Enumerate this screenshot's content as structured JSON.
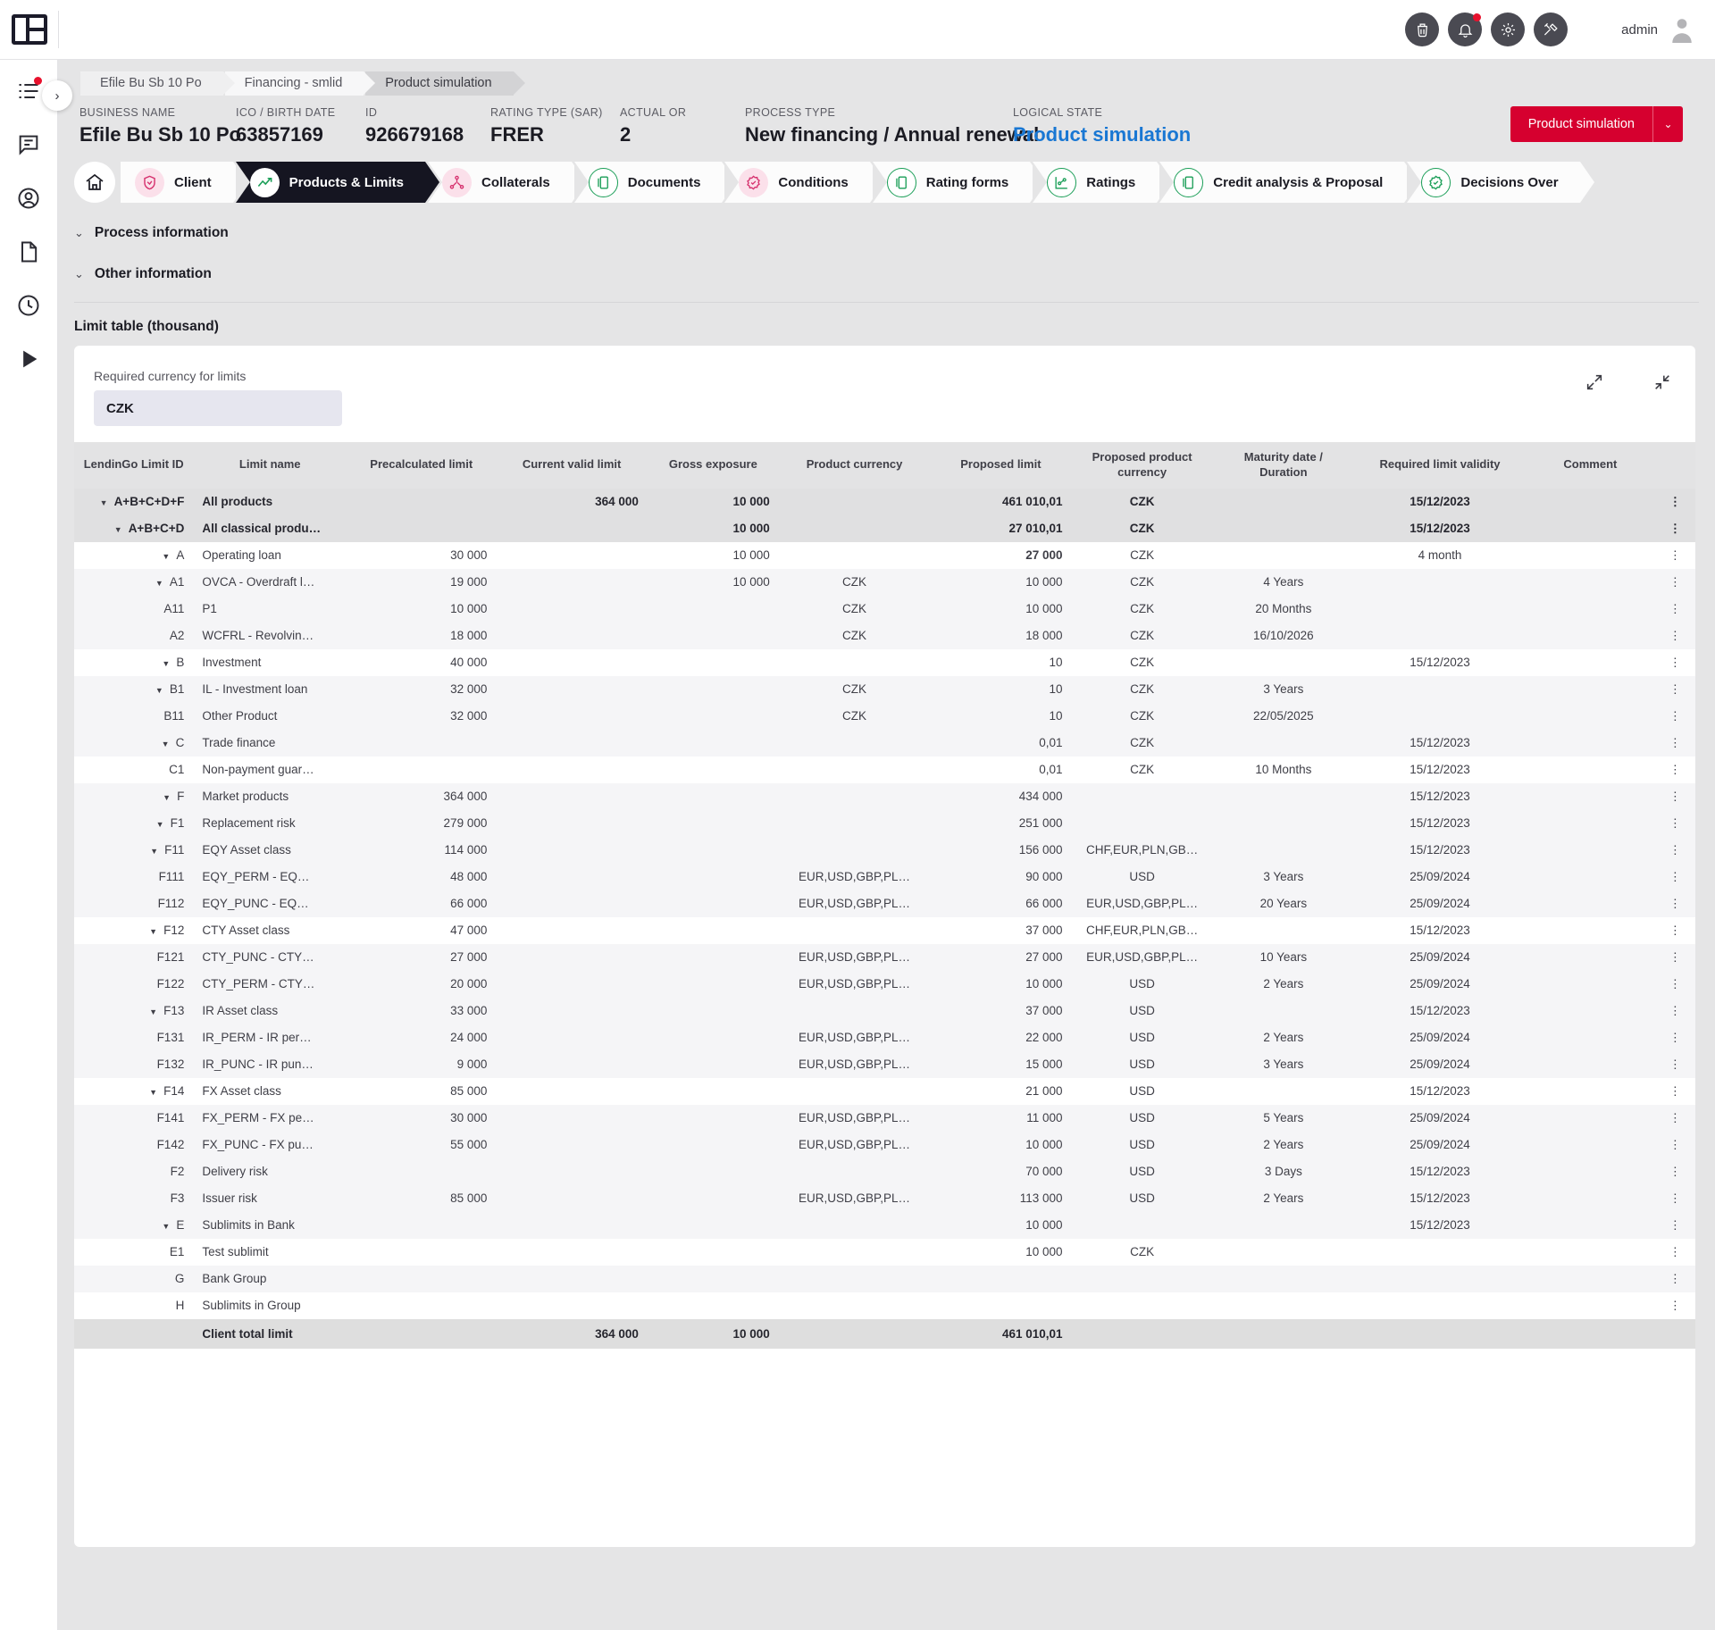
{
  "topbar": {
    "icons": [
      "shield-icon",
      "bell-icon",
      "gear-icon",
      "tools-icon"
    ],
    "user": "admin"
  },
  "rail": {
    "items": [
      "task-list-icon",
      "comment-icon",
      "user-circle-icon",
      "document-icon",
      "clock-icon",
      "play-icon"
    ],
    "expand": "›"
  },
  "breadcrumb": {
    "items": [
      "Efile Bu Sb 10 Po",
      "Financing - smlid",
      "Product simulation"
    ]
  },
  "summary": {
    "fields": [
      {
        "label": "BUSINESS NAME",
        "value": "Efile Bu Sb 10 Po"
      },
      {
        "label": "ICO / BIRTH DATE",
        "value": "63857169"
      },
      {
        "label": "ID",
        "value": "926679168"
      },
      {
        "label": "RATING TYPE (SAR)",
        "value": "FRER"
      },
      {
        "label": "ACTUAL OR",
        "value": "2"
      },
      {
        "label": "PROCESS TYPE",
        "value": "New financing / Annual renewal"
      },
      {
        "label": "LOGICAL STATE",
        "value": "Product simulation"
      }
    ],
    "action_button": "Product simulation",
    "action_caret": "⌄"
  },
  "steps": [
    {
      "label": "Client",
      "icon": "shield-heart-icon"
    },
    {
      "label": "Products & Limits",
      "icon": "trend-up-icon"
    },
    {
      "label": "Collaterals",
      "icon": "collateral-icon"
    },
    {
      "label": "Documents",
      "icon": "documents-icon"
    },
    {
      "label": "Conditions",
      "icon": "check-badge-icon"
    },
    {
      "label": "Rating forms",
      "icon": "documents-icon"
    },
    {
      "label": "Ratings",
      "icon": "graph-icon"
    },
    {
      "label": "Credit analysis & Proposal",
      "icon": "documents-icon"
    },
    {
      "label": "Decisions Over",
      "icon": "check-badge-icon"
    }
  ],
  "accordions": [
    {
      "label": "Process information",
      "chevron": "⌄"
    },
    {
      "label": "Other information",
      "chevron": "⌄"
    }
  ],
  "limit_table": {
    "title": "Limit table (thousand)",
    "currency_label": "Required currency for limits",
    "currency_value": "CZK",
    "tools": [
      "expand-icon",
      "collapse-icon"
    ],
    "row_menu": "⋮",
    "columns": [
      "LendinGo Limit ID",
      "Limit name",
      "Precalculated limit",
      "Current valid limit",
      "Gross exposure",
      "Product currency",
      "Proposed limit",
      "Proposed product currency",
      "Maturity date / Duration",
      "Required limit validity",
      "Comment"
    ],
    "rows": [
      {
        "id": "A+B+C+D+F",
        "indent": 0,
        "caret": true,
        "name": "All products",
        "pre": "",
        "cur": "364 000",
        "gross": "10 000",
        "pcur": "",
        "prop": "461 010,01",
        "propbold": false,
        "ppcur": "CZK",
        "mat": "",
        "val": "15/12/2023",
        "com": "",
        "style": "head"
      },
      {
        "id": "A+B+C+D",
        "indent": 1,
        "caret": true,
        "name": "All classical produ…",
        "pre": "",
        "cur": "",
        "gross": "10 000",
        "pcur": "",
        "prop": "27 010,01",
        "propbold": false,
        "ppcur": "CZK",
        "mat": "",
        "val": "15/12/2023",
        "com": "",
        "style": "head"
      },
      {
        "id": "A",
        "indent": 2,
        "caret": true,
        "name": "Operating loan",
        "pre": "30 000",
        "cur": "",
        "gross": "10 000",
        "pcur": "",
        "prop": "27 000",
        "propbold": true,
        "ppcur": "CZK",
        "mat": "",
        "val": "4 month",
        "com": "",
        "style": "even"
      },
      {
        "id": "A1",
        "indent": 3,
        "caret": true,
        "name": "OVCA - Overdraft l…",
        "pre": "19 000",
        "cur": "",
        "gross": "10 000",
        "pcur": "CZK",
        "prop": "10 000",
        "propbold": false,
        "ppcur": "CZK",
        "mat": "4 Years",
        "val": "",
        "com": "",
        "style": "odd"
      },
      {
        "id": "A11",
        "indent": 4,
        "caret": false,
        "name": "P1",
        "pre": "10 000",
        "cur": "",
        "gross": "",
        "pcur": "CZK",
        "prop": "10 000",
        "propbold": false,
        "ppcur": "CZK",
        "mat": "20 Months",
        "val": "",
        "com": "",
        "style": "odd"
      },
      {
        "id": "A2",
        "indent": 4,
        "caret": false,
        "name": "WCFRL - Revolvin…",
        "pre": "18 000",
        "cur": "",
        "gross": "",
        "pcur": "CZK",
        "prop": "18 000",
        "propbold": false,
        "ppcur": "CZK",
        "mat": "16/10/2026",
        "val": "",
        "com": "",
        "style": "odd"
      },
      {
        "id": "B",
        "indent": 2,
        "caret": true,
        "name": "Investment",
        "pre": "40 000",
        "cur": "",
        "gross": "",
        "pcur": "",
        "prop": "10",
        "propbold": false,
        "ppcur": "CZK",
        "mat": "",
        "val": "15/12/2023",
        "com": "",
        "style": "even"
      },
      {
        "id": "B1",
        "indent": 3,
        "caret": true,
        "name": "IL - Investment loan",
        "pre": "32 000",
        "cur": "",
        "gross": "",
        "pcur": "CZK",
        "prop": "10",
        "propbold": false,
        "ppcur": "CZK",
        "mat": "3 Years",
        "val": "",
        "com": "",
        "style": "odd"
      },
      {
        "id": "B11",
        "indent": 4,
        "caret": false,
        "name": "Other Product",
        "pre": "32 000",
        "cur": "",
        "gross": "",
        "pcur": "CZK",
        "prop": "10",
        "propbold": false,
        "ppcur": "CZK",
        "mat": "22/05/2025",
        "val": "",
        "com": "",
        "style": "odd"
      },
      {
        "id": "C",
        "indent": 2,
        "caret": true,
        "name": "Trade finance",
        "pre": "",
        "cur": "",
        "gross": "",
        "pcur": "",
        "prop": "0,01",
        "propbold": false,
        "ppcur": "CZK",
        "mat": "",
        "val": "15/12/2023",
        "com": "",
        "style": "odd"
      },
      {
        "id": "C1",
        "indent": 3,
        "caret": false,
        "name": "Non-payment guar…",
        "pre": "",
        "cur": "",
        "gross": "",
        "pcur": "",
        "prop": "0,01",
        "propbold": false,
        "ppcur": "CZK",
        "mat": "10 Months",
        "val": "15/12/2023",
        "com": "",
        "style": "even"
      },
      {
        "id": "F",
        "indent": 2,
        "caret": true,
        "name": "Market products",
        "pre": "364 000",
        "cur": "",
        "gross": "",
        "pcur": "",
        "prop": "434 000",
        "propbold": false,
        "ppcur": "",
        "mat": "",
        "val": "15/12/2023",
        "com": "",
        "style": "odd"
      },
      {
        "id": "F1",
        "indent": 3,
        "caret": true,
        "name": "Replacement risk",
        "pre": "279 000",
        "cur": "",
        "gross": "",
        "pcur": "",
        "prop": "251 000",
        "propbold": false,
        "ppcur": "",
        "mat": "",
        "val": "15/12/2023",
        "com": "",
        "style": "odd"
      },
      {
        "id": "F11",
        "indent": 4,
        "caret": true,
        "name": "EQY Asset class",
        "pre": "114 000",
        "cur": "",
        "gross": "",
        "pcur": "",
        "prop": "156 000",
        "propbold": false,
        "ppcur": "CHF,EUR,PLN,GB…",
        "mat": "",
        "val": "15/12/2023",
        "com": "",
        "style": "odd"
      },
      {
        "id": "F111",
        "indent": 5,
        "caret": false,
        "name": "EQY_PERM - EQ…",
        "pre": "48 000",
        "cur": "",
        "gross": "",
        "pcur": "EUR,USD,GBP,PL…",
        "prop": "90 000",
        "propbold": false,
        "ppcur": "USD",
        "mat": "3 Years",
        "val": "25/09/2024",
        "com": "",
        "style": "odd"
      },
      {
        "id": "F112",
        "indent": 5,
        "caret": false,
        "name": "EQY_PUNC - EQ…",
        "pre": "66 000",
        "cur": "",
        "gross": "",
        "pcur": "EUR,USD,GBP,PL…",
        "prop": "66 000",
        "propbold": false,
        "ppcur": "EUR,USD,GBP,PL…",
        "mat": "20 Years",
        "val": "25/09/2024",
        "com": "",
        "style": "odd"
      },
      {
        "id": "F12",
        "indent": 4,
        "caret": true,
        "name": "CTY Asset class",
        "pre": "47 000",
        "cur": "",
        "gross": "",
        "pcur": "",
        "prop": "37 000",
        "propbold": false,
        "ppcur": "CHF,EUR,PLN,GB…",
        "mat": "",
        "val": "15/12/2023",
        "com": "",
        "style": "even"
      },
      {
        "id": "F121",
        "indent": 5,
        "caret": false,
        "name": "CTY_PUNC - CTY…",
        "pre": "27 000",
        "cur": "",
        "gross": "",
        "pcur": "EUR,USD,GBP,PL…",
        "prop": "27 000",
        "propbold": false,
        "ppcur": "EUR,USD,GBP,PL…",
        "mat": "10 Years",
        "val": "25/09/2024",
        "com": "",
        "style": "odd"
      },
      {
        "id": "F122",
        "indent": 5,
        "caret": false,
        "name": "CTY_PERM - CTY…",
        "pre": "20 000",
        "cur": "",
        "gross": "",
        "pcur": "EUR,USD,GBP,PL…",
        "prop": "10 000",
        "propbold": false,
        "ppcur": "USD",
        "mat": "2 Years",
        "val": "25/09/2024",
        "com": "",
        "style": "odd"
      },
      {
        "id": "F13",
        "indent": 4,
        "caret": true,
        "name": "IR Asset class",
        "pre": "33 000",
        "cur": "",
        "gross": "",
        "pcur": "",
        "prop": "37 000",
        "propbold": false,
        "ppcur": "USD",
        "mat": "",
        "val": "15/12/2023",
        "com": "",
        "style": "odd"
      },
      {
        "id": "F131",
        "indent": 5,
        "caret": false,
        "name": "IR_PERM - IR per…",
        "pre": "24 000",
        "cur": "",
        "gross": "",
        "pcur": "EUR,USD,GBP,PL…",
        "prop": "22 000",
        "propbold": false,
        "ppcur": "USD",
        "mat": "2 Years",
        "val": "25/09/2024",
        "com": "",
        "style": "odd"
      },
      {
        "id": "F132",
        "indent": 5,
        "caret": false,
        "name": "IR_PUNC - IR pun…",
        "pre": "9 000",
        "cur": "",
        "gross": "",
        "pcur": "EUR,USD,GBP,PL…",
        "prop": "15 000",
        "propbold": false,
        "ppcur": "USD",
        "mat": "3 Years",
        "val": "25/09/2024",
        "com": "",
        "style": "odd"
      },
      {
        "id": "F14",
        "indent": 4,
        "caret": true,
        "name": "FX Asset class",
        "pre": "85 000",
        "cur": "",
        "gross": "",
        "pcur": "",
        "prop": "21 000",
        "propbold": false,
        "ppcur": "USD",
        "mat": "",
        "val": "15/12/2023",
        "com": "",
        "style": "even"
      },
      {
        "id": "F141",
        "indent": 5,
        "caret": false,
        "name": "FX_PERM - FX pe…",
        "pre": "30 000",
        "cur": "",
        "gross": "",
        "pcur": "EUR,USD,GBP,PL…",
        "prop": "11 000",
        "propbold": false,
        "ppcur": "USD",
        "mat": "5 Years",
        "val": "25/09/2024",
        "com": "",
        "style": "odd"
      },
      {
        "id": "F142",
        "indent": 5,
        "caret": false,
        "name": "FX_PUNC - FX pu…",
        "pre": "55 000",
        "cur": "",
        "gross": "",
        "pcur": "EUR,USD,GBP,PL…",
        "prop": "10 000",
        "propbold": false,
        "ppcur": "USD",
        "mat": "2 Years",
        "val": "25/09/2024",
        "com": "",
        "style": "odd"
      },
      {
        "id": "F2",
        "indent": 4,
        "caret": false,
        "name": "Delivery risk",
        "pre": "",
        "cur": "",
        "gross": "",
        "pcur": "",
        "prop": "70 000",
        "propbold": false,
        "ppcur": "USD",
        "mat": "3 Days",
        "val": "15/12/2023",
        "com": "",
        "style": "odd"
      },
      {
        "id": "F3",
        "indent": 4,
        "caret": false,
        "name": "Issuer risk",
        "pre": "85 000",
        "cur": "",
        "gross": "",
        "pcur": "EUR,USD,GBP,PL…",
        "prop": "113 000",
        "propbold": false,
        "ppcur": "USD",
        "mat": "2 Years",
        "val": "15/12/2023",
        "com": "",
        "style": "odd"
      },
      {
        "id": "E",
        "indent": 2,
        "caret": true,
        "name": "Sublimits in Bank",
        "pre": "",
        "cur": "",
        "gross": "",
        "pcur": "",
        "prop": "10 000",
        "propbold": false,
        "ppcur": "",
        "mat": "",
        "val": "15/12/2023",
        "com": "",
        "style": "odd"
      },
      {
        "id": "E1",
        "indent": 3,
        "caret": false,
        "name": "Test sublimit",
        "pre": "",
        "cur": "",
        "gross": "",
        "pcur": "",
        "prop": "10 000",
        "propbold": false,
        "ppcur": "CZK",
        "mat": "",
        "val": "",
        "com": "",
        "style": "even"
      },
      {
        "id": "G",
        "indent": 2,
        "caret": false,
        "name": "Bank Group",
        "pre": "",
        "cur": "",
        "gross": "",
        "pcur": "",
        "prop": "",
        "propbold": false,
        "ppcur": "",
        "mat": "",
        "val": "",
        "com": "",
        "style": "odd"
      },
      {
        "id": "H",
        "indent": 2,
        "caret": false,
        "name": "Sublimits in Group",
        "pre": "",
        "cur": "",
        "gross": "",
        "pcur": "",
        "prop": "",
        "propbold": false,
        "ppcur": "",
        "mat": "",
        "val": "",
        "com": "",
        "style": "even"
      }
    ],
    "footer": {
      "id": "",
      "name": "Client total limit",
      "pre": "",
      "cur": "364 000",
      "gross": "10 000",
      "pcur": "",
      "prop": "461 010,01",
      "ppcur": "",
      "mat": "",
      "val": "",
      "com": ""
    }
  }
}
